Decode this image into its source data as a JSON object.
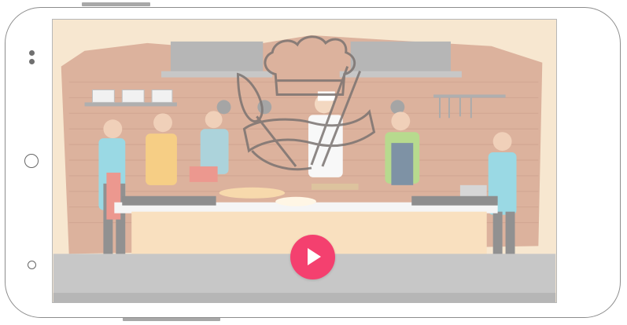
{
  "device": {
    "type": "phone-landscape",
    "frame_color": "#8d8d8d"
  },
  "video": {
    "thumbnail": "cooking-class-illustration",
    "watermark": "chef-hat-logo",
    "play_button": {
      "icon": "play-icon",
      "color": "#f4406f"
    }
  },
  "nav": {
    "home_icon": "home-circle-icon",
    "back_icon": "back-circle-icon",
    "indicator_icon": "status-dots-icon"
  }
}
